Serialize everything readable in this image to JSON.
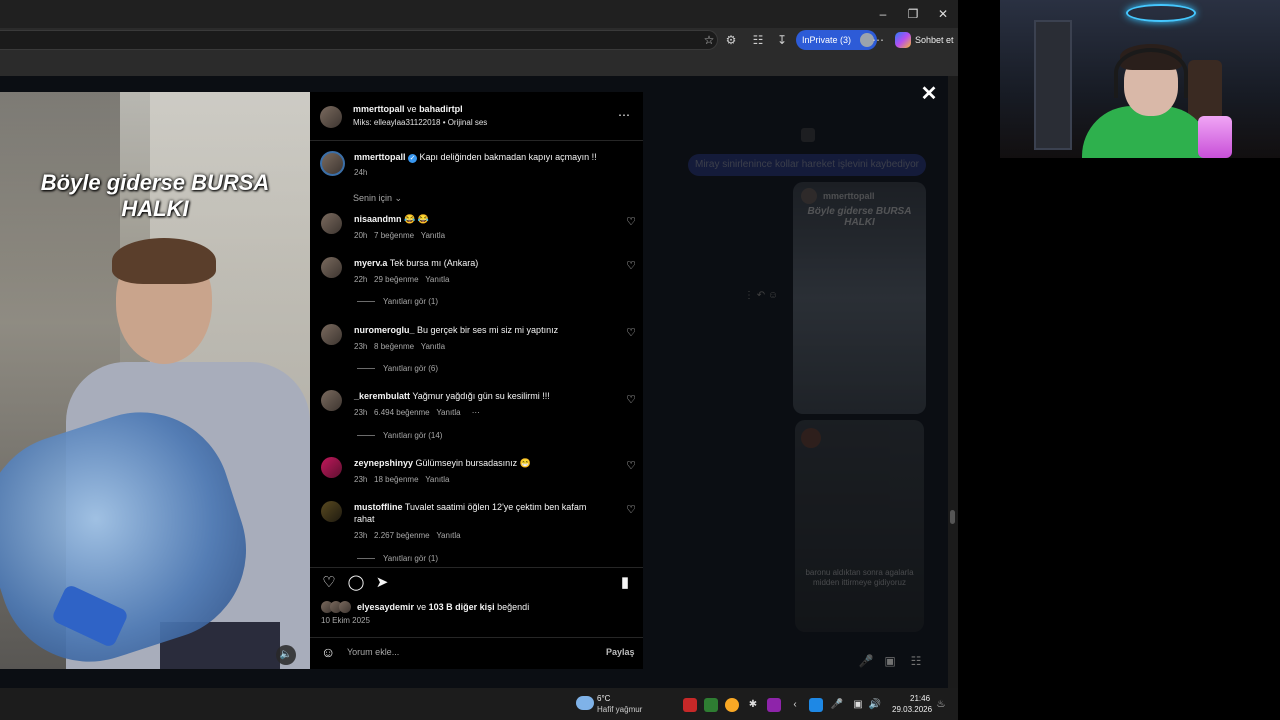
{
  "browser": {
    "inprivate_label": "InPrivate (3)",
    "copilot_label": "Sohbet et"
  },
  "dm": {
    "bubble_text": "Miray sinirlenince kollar hareket işlevini kaybediyor",
    "card1_user": "mmerttopall",
    "card1_title": "Böyle giderse BURSA HALKI",
    "card2_caption": "baronu aldıktan sonra agalarla midden ittirmeye gidiyoruz"
  },
  "video": {
    "title_line1": "Böyle giderse BURSA",
    "title_line2": "HALKI"
  },
  "post": {
    "author": "mmerttopall",
    "connector": "ve",
    "coauthor": "bahadirtpl",
    "audio": "Miks: elleaylaa31122018 • Orijinal ses",
    "caption_user": "mmerttopall",
    "caption_text": "Kapı deliğinden bakmadan kapıyı açmayın !!",
    "caption_time": "24h",
    "sort_label": "Senin için",
    "likes_user": "elyesaydemir",
    "likes_mid": "ve",
    "likes_rest": "103 B diğer kişi",
    "likes_suffix": "beğendi",
    "date": "10 Ekim 2025",
    "comment_placeholder": "Yorum ekle...",
    "share_label": "Paylaş"
  },
  "comments": [
    {
      "user": "nisaandmn",
      "text": "😂 😂",
      "time": "20h",
      "likes": "7 beğenme",
      "reply": "Yanıtla",
      "view_replies": ""
    },
    {
      "user": "myerv.a",
      "text": "Tek bursa mı (Ankara)",
      "time": "22h",
      "likes": "29 beğenme",
      "reply": "Yanıtla",
      "view_replies": "Yanıtları gör (1)"
    },
    {
      "user": "nuromeroglu_",
      "text": "Bu gerçek bir ses mi siz mi yaptınız",
      "time": "23h",
      "likes": "8 beğenme",
      "reply": "Yanıtla",
      "view_replies": "Yanıtları gör (6)"
    },
    {
      "user": "_kerembulatt",
      "text": "Yağmur yağdığı gün su kesilirmi !!!",
      "time": "23h",
      "likes": "6.494 beğenme",
      "reply": "Yanıtla",
      "view_replies": "Yanıtları gör (14)"
    },
    {
      "user": "zeynepshinyy",
      "text": "Gülümseyin bursadasınız 😁",
      "time": "23h",
      "likes": "18 beğenme",
      "reply": "Yanıtla",
      "view_replies": ""
    },
    {
      "user": "mustoffline",
      "text": "Tuvalet saatimi öğlen 12'ye çektim ben kafam",
      "text2": "rahat",
      "time": "23h",
      "likes": "2.267 beğenme",
      "reply": "Yanıtla",
      "view_replies": "Yanıtları gör (1)"
    }
  ],
  "taskbar": {
    "temp": "6°C",
    "weather": "Hafif yağmur",
    "time": "21:46",
    "date": "29.03.2026"
  },
  "colors": {
    "accent": "#2d5bd7",
    "verified": "#3897f0",
    "panel_bg": "#000000"
  }
}
